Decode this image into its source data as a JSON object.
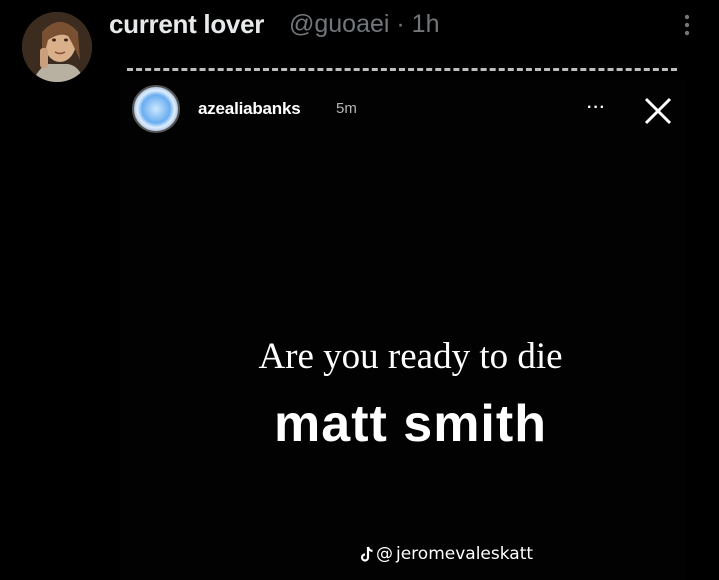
{
  "tweet": {
    "author_name": "current lover",
    "author_handle": "@guoaei",
    "separator": " · ",
    "timestamp": "1h",
    "meta_text": "@guoaei · 1h",
    "avatar_icon": "profile-photo",
    "more_icon": "more-vertical-icon"
  },
  "media": {
    "story": {
      "username": "azealiabanks",
      "time": "5m",
      "menu_dots": "···",
      "close_icon": "close-icon",
      "text": "Are you ready to die"
    },
    "overlay_caption": "matt smith",
    "watermark": {
      "icon": "tiktok-icon",
      "at": "@",
      "handle": "jeromevaleskatt"
    }
  },
  "colors": {
    "background": "#000000",
    "name_text": "#e7e9ea",
    "meta_text": "#71767b",
    "story_text": "#ffffff",
    "dash_line": "#bdbdbd"
  }
}
